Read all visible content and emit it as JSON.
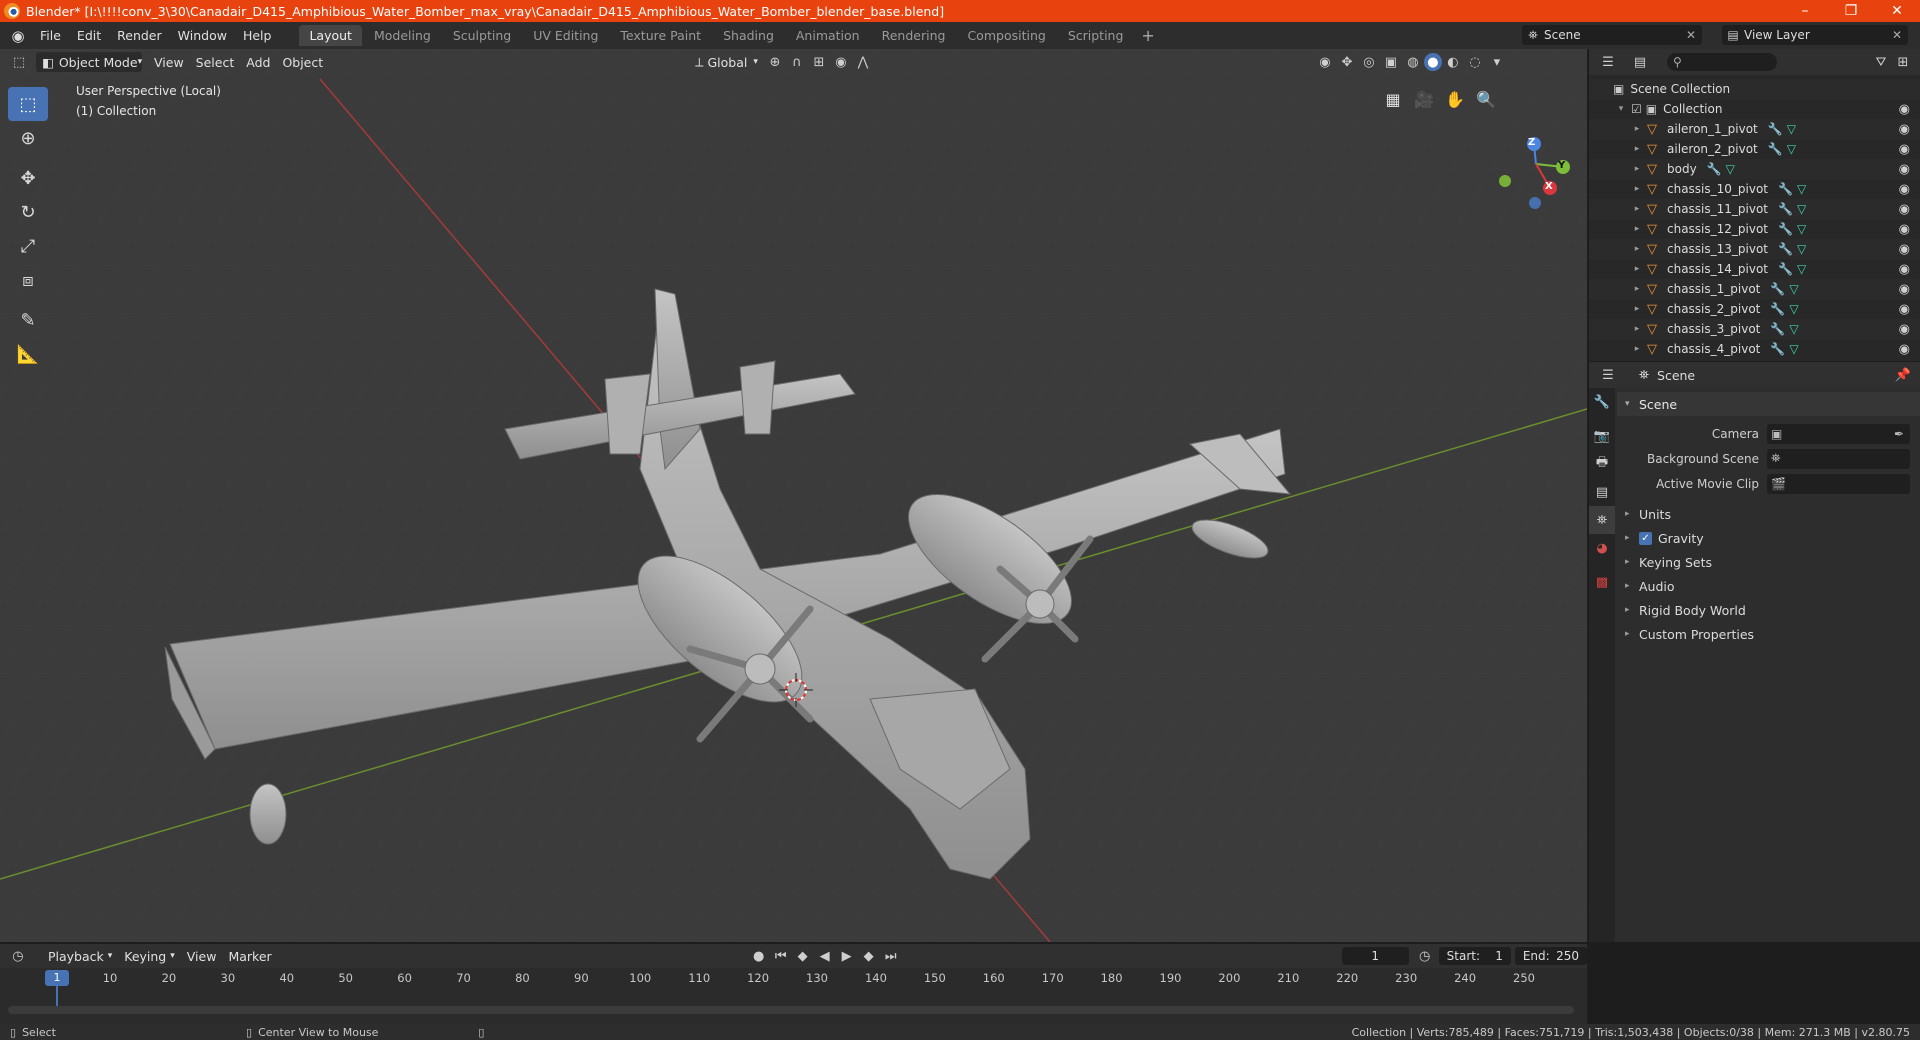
{
  "window": {
    "title": "Blender* [I:\\!!!!conv_3\\30\\Canadair_D415_Amphibious_Water_Bomber_max_vray\\Canadair_D415_Amphibious_Water_Bomber_blender_base.blend]",
    "minimize": "–",
    "maximize": "❐",
    "close": "✕"
  },
  "menu": [
    "File",
    "Edit",
    "Render",
    "Window",
    "Help"
  ],
  "workspaces": [
    "Layout",
    "Modeling",
    "Sculpting",
    "UV Editing",
    "Texture Paint",
    "Shading",
    "Animation",
    "Rendering",
    "Compositing",
    "Scripting"
  ],
  "active_workspace": "Layout",
  "scene_name": "Scene",
  "view_layer": "View Layer",
  "viewport": {
    "mode": "Object Mode",
    "menus": [
      "View",
      "Select",
      "Add",
      "Object"
    ],
    "orientation": "Global",
    "overlay_line1": "User Perspective (Local)",
    "overlay_line2": "(1) Collection",
    "gizmo": {
      "x": "X",
      "y": "Y",
      "z": "Z"
    }
  },
  "outliner": {
    "root": "Scene Collection",
    "collection": "Collection",
    "items": [
      {
        "name": "aileron_1_pivot"
      },
      {
        "name": "aileron_2_pivot"
      },
      {
        "name": "body"
      },
      {
        "name": "chassis_10_pivot"
      },
      {
        "name": "chassis_11_pivot"
      },
      {
        "name": "chassis_12_pivot"
      },
      {
        "name": "chassis_13_pivot"
      },
      {
        "name": "chassis_14_pivot"
      },
      {
        "name": "chassis_1_pivot"
      },
      {
        "name": "chassis_2_pivot"
      },
      {
        "name": "chassis_3_pivot"
      },
      {
        "name": "chassis_4_pivot"
      }
    ]
  },
  "properties": {
    "context": "Scene",
    "panel": "Scene",
    "camera_label": "Camera",
    "bg_scene_label": "Background Scene",
    "movie_clip_label": "Active Movie Clip",
    "subpanels": [
      "Units",
      "Gravity",
      "Keying Sets",
      "Audio",
      "Rigid Body World",
      "Custom Properties"
    ],
    "gravity_checked": true
  },
  "timeline": {
    "menus": [
      "Playback",
      "Keying",
      "View",
      "Marker"
    ],
    "current_frame": "1",
    "start_label": "Start:",
    "start": "1",
    "end_label": "End:",
    "end": "250",
    "ticks": [
      "1",
      "10",
      "20",
      "30",
      "40",
      "50",
      "60",
      "70",
      "80",
      "90",
      "100",
      "110",
      "120",
      "130",
      "140",
      "150",
      "160",
      "170",
      "180",
      "190",
      "200",
      "210",
      "220",
      "230",
      "240",
      "250"
    ]
  },
  "status": {
    "left1": "Select",
    "left2": "Center View to Mouse",
    "right": "Collection | Verts:785,489 | Faces:751,719 | Tris:1,503,438 | Objects:0/38 | Mem: 271.3 MB | v2.80.75"
  },
  "colors": {
    "accent": "#4772b3",
    "titlebar": "#e8430e",
    "x_axis": "#d9383d",
    "y_axis": "#7ebd3a",
    "z_axis": "#4c86e0"
  }
}
